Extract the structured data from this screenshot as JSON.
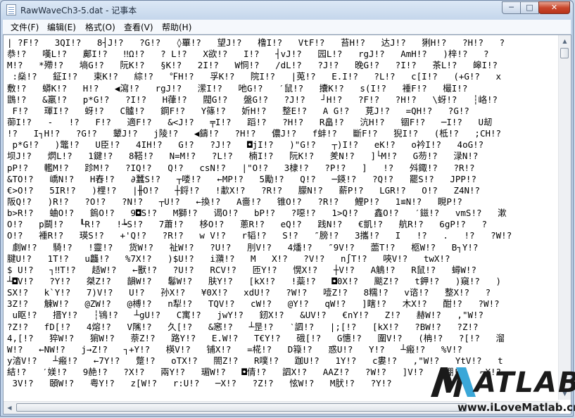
{
  "window": {
    "title": "RawWaveCh3-5.dat - 记事本",
    "controls": {
      "minimize": "─",
      "maximize": "□",
      "close": "✕"
    }
  },
  "menu": [
    "文件(F)",
    "编辑(E)",
    "格式(O)",
    "查看(V)",
    "帮助(H)"
  ],
  "content": {
    "lines": [
      "| ?F!?   3QI!?   8┤J!?   ?G!?   ◊罼!?   望J!?   橹I!?   VtF!?   苔H!?   达J!?   猁H!?   ?H!?   ?",
      "恭!?   嘆L!?   鄺I!?   ‼Ω!?   ? L!?   X欲!?   I!?   ┤vJ!?   园L!?   rgJ!?   AmH!?   )梓!?   ?",
      "M!?   *殢!?   墒G!?   阮K!?   §K!?   2I!?   W恫!?   /dL!?   ?J!?   晚G!?   ?I!?   茶L!?   皞I!?",
      " :燊!?   鉦I!?   束K!?   綜!?   ℉H!?   孚K!?   院I!?   |莵!?   E.I!?   ?L!?   c[I!?   (+G!?   x",
      "敷!?   蟒K!?   H!?   ◀瀉!?   rgJ!?   潆I!?   吔G!?   ′鼠!?   攮K!?   s(I!?   褈F!?   樶I!?",
      "鵾!?   &羸!?   p*G!?   ?I!?   H葎!?   閥G!?   盤G!?   ?J!?   ┘H!?   ?F!?   ?H!?   \\蚜!?   ┆峈!?",
      " F!?   琿I!?   蚜!?   C髗!?   鋼F!?   Y篠!?   妡H!?   整E!?   A G!?   莧J!?   =QH!?   ?G!?",
      "蓹I!?   -   !?   F!?   適F!?   &<J!?   ╤I!?   蹈!?   ?H!?   R畠!?   沆H!?   锢F!?   ─I!?   U刼",
      "!?   I┐H!?   ?G!?   顰J!?   j陵!?   ◀鑄!?   ?H!?   儂J!?   f蚌!?   斷F!?   猊I!?   (柢!?   ;CH!?",
      " p*G!?   )鼈!?   U臣!?   4IH!?   G!?   ?J!?   ◘jI!?   )\"G!?   ┬)I!?   eK!?   o衿I!?   4oG!?",
      "坝J!?   熌L!?   1鍵!?   8鞳!?   N=M!?   ?L!?   楠I!?   阮K!?   羑N!?   ]└M!?   G芴!?   渌N!?",
      "pP!?   轞M!?   跈M!?   ?IQ!?   Q!?   csN!?   |\"O!?   3棣!?   ?P!?   ]   !?   斘鋷!?   ?R!?",
      "&TO!?   嶠N!?   H舂!?   ∂蠶S!?   ┬喽!?   ←MP!?   5勵!?   Q!?   ─鍈!?   ?Q!?   罷S!?   JPP!?",
      "€>O!?   5IR!?   )梩!?   |╫O!?   ┼鋝!?   !歗X!?   ?R!?   朦N!?   薪P!?   LGR!?   O!?   Z4N!?",
      "阪Q!?   )R!?   ?O!?   ?N!?   ┬U!?   ←換!?   A嗇!?   锥O!?   ?R!?   鯉P!?   1≌N!?   睍P!?",
      "b>R!?   蛐O!?   鎢O!?   9◘S!?   M獅!?   谒O!?   bP!?   ?噁!?   1>Q!?   鑫O!?   ′鎡!?   vmS!?   漱",
      "O!?   p鬬!?   ┖R!?   !┶S!?   7蕭!?   栘O!?   蔥R!?   eQ!?   践N!?   €凱!?   航R!?   6gP!?   ?",
      "O!?   褈R!?   瑛S!?   +'Q!?   ?R!?   w V!?   r韬!?   S!?   ″膀!?   3攜!?   I   !?   .   !?   ?W!?",
      " 劇W!?   騎!?   !靈!?   货W!?   祉W!?   ?U!?   刖V!?   4燔!?   ″9V!?   蘦T!?   柩W!?   B┐Y!?",
      "腱U!?   1T!?   u龘!?   %7X!?   )$U!?   i濻!?   M   X!?   ?V!?   n∫T!?   唊V!?   twX!?",
      "$ U!?   ┐‼T!?   趏W!?   ←獸!?   ?U!?   RCV!?   匝Y!?   愰X!?   ┼V!?   A鵤!?   R鼠!?   蟳W!?",
      "┴◘V!?   ?Y!?   桀Z!?   韻W!?   鬈W!?   肤Y!?   [kX!?   !蘂!?   ◘0X!?   颷Z!?   t鉀!?   )窺!?   )",
      "SX!?   k`Y!?   7)V!?   U!?   孙X!?   ¥0X!?   xdU!?   ?W!?   噎Z!?   8糯!?   v谘!?   整X!?   ?",
      "3Z!?   觫W!?   @ZW!?   @榑!?   n犁!?   TQV!?   cW!?   @Y!?   qW!?   ]瞎!?   木X!?   酣!?   ?W!?",
      " u眍!?   搢Y!?   ┆鴇!?   ┴gU!?   C寓!?   jwY!?   釰X!?   &UV!?   €nY!?   Z!?   赫W!?   ,\"W!?",
      "?Z!?   fD[!?   4熔!?   V隲!?   久[!?   &窸!?   ┴昰!?   ‵訵!?   |;[!?   [kX!?   ?BW!?   ?Z!?",
      "4,[!?   猝W!?   猏W!?   萘Z!?   路Y!?   E.W!?   T€Y!?   硪[!?   G憓!?   圍V!?   (柟!?   ?[!?   溜",
      "W!?   ←NW!?   j→Z!?   ┐+Y!?   楧V!?   铺X!?   =椛!?   D簶!?   惑U!?   Y!?   ┴瘢!?   %V!?",
      "y涾V!?   ┴瘢!?   ←7Y!?   蹩!?   oTX!?   閤Z!?   R噗!?   跏U!?   1Y!?   c婁!?   ,\"W!?   YtV!?   t",
      "結!?   ′媄!?   9赩!?   ?X!?   兩Y!?   瑂W!?   ◘倩!?   訵X!?   AAZ!?   ?W!?   ]V!?   ′錋!?   ⌐X!?",
      " 3V!?   頣W!?   粤Y!?   z[W!?   r:U!?   ─X!?   ?Z!?   怰W!?   M肰!?   ?Y!?"
    ]
  },
  "watermark": {
    "logo_text": "ATLAB",
    "url": "www.iLoveMatlab.cn"
  }
}
